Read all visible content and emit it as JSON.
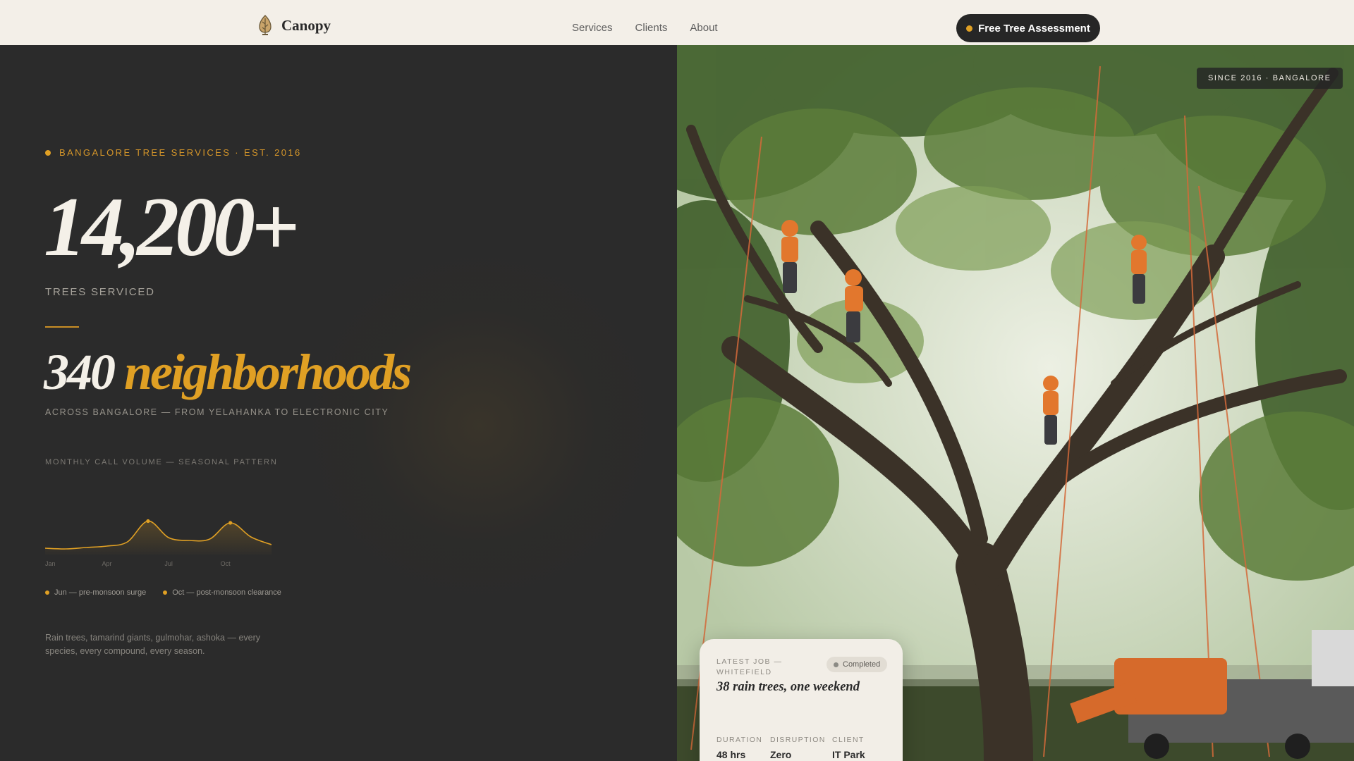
{
  "nav": {
    "brand": "Canopy",
    "links": [
      "Services",
      "Clients",
      "About"
    ],
    "cta_label": "Free Tree Assessment"
  },
  "hero": {
    "eyebrow": "BANGALORE TREE SERVICES · EST. 2016",
    "big_number": "14,200+",
    "big_label": "TREES SERVICED",
    "neighborhoods_number": "340",
    "neighborhoods_word": "neighborhoods",
    "neighborhoods_sub": "ACROSS BANGALORE — FROM YELAHANKA TO ELECTRONIC CITY",
    "description": "Rain trees, tamarind giants, gulmohar, ashoka — every species, every compound, every season."
  },
  "chart_data": {
    "type": "area",
    "title": "MONTHLY CALL VOLUME — SEASONAL PATTERN",
    "x": [
      "Jan",
      "Feb",
      "Mar",
      "Apr",
      "May",
      "Jun",
      "Jul",
      "Aug",
      "Sep",
      "Oct",
      "Nov",
      "Dec"
    ],
    "values": [
      18,
      16,
      20,
      24,
      36,
      95,
      48,
      40,
      44,
      90,
      50,
      28
    ],
    "tick_labels": [
      "Jan",
      "Apr",
      "Jul",
      "Oct"
    ],
    "ylim": [
      0,
      100
    ],
    "grid": false,
    "color": "#e0a024",
    "peaks": [
      "Jun",
      "Oct"
    ],
    "legend": [
      "Jun — pre-monsoon surge",
      "Oct — post-monsoon clearance"
    ],
    "legend_position": "bottom"
  },
  "badge": "SINCE 2016 · BANGALORE",
  "job_card": {
    "eyebrow": "LATEST JOB — WHITEFIELD",
    "status": "Completed",
    "title": "38 rain trees, one weekend",
    "stats": [
      {
        "label": "DURATION",
        "value": "48 hrs"
      },
      {
        "label": "DISRUPTION",
        "value": "Zero"
      },
      {
        "label": "CLIENT",
        "value": "IT Park"
      }
    ]
  },
  "colors": {
    "accent": "#e0a024",
    "dark_panel": "#2b2b2b",
    "nav_bg": "#f3efe8",
    "card_bg": "#f2eee7"
  },
  "icons": {
    "logo": "tree-icon",
    "cta": "dot-icon",
    "status": "dot-icon"
  }
}
